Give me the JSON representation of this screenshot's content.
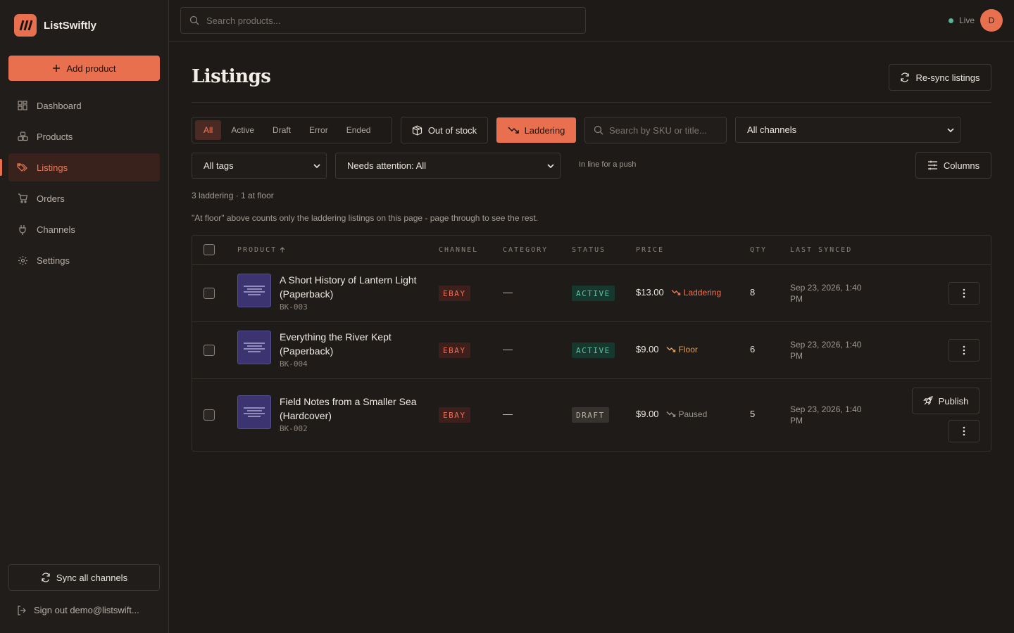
{
  "app": {
    "name": "ListSwiftly"
  },
  "sidebar": {
    "add_button": "Add product",
    "items": [
      {
        "label": "Dashboard",
        "icon": "grid-icon"
      },
      {
        "label": "Products",
        "icon": "boxes-icon"
      },
      {
        "label": "Listings",
        "icon": "tags-icon",
        "active": true
      },
      {
        "label": "Orders",
        "icon": "cart-icon"
      },
      {
        "label": "Channels",
        "icon": "plug-icon"
      },
      {
        "label": "Settings",
        "icon": "gear-icon"
      }
    ],
    "sync_all": "Sync all channels",
    "sign_out": "Sign out demo@listswift..."
  },
  "topbar": {
    "search_placeholder": "Search products...",
    "live_label": "Live",
    "avatar_initial": "D"
  },
  "page": {
    "title": "Listings",
    "resync_button": "Re-sync listings"
  },
  "filters": {
    "status_tabs": [
      "All",
      "Active",
      "Draft",
      "Error",
      "Ended"
    ],
    "active_status_tab": "All",
    "out_of_stock": "Out of stock",
    "laddering": "Laddering",
    "search_placeholder": "Search by SKU or title...",
    "channel_select": "All channels",
    "tags_select": "All tags",
    "attention_select": "Needs attention: All",
    "inline_note": "In line for a push",
    "columns_button": "Columns"
  },
  "summary": "3 laddering · 1 at floor",
  "note": "\"At floor\" above counts only the laddering listings on this page - page through to see the rest.",
  "table": {
    "headers": {
      "product": "PRODUCT",
      "channel": "CHANNEL",
      "category": "CATEGORY",
      "status": "STATUS",
      "price": "PRICE",
      "qty": "QTY",
      "last_synced": "LAST SYNCED"
    },
    "rows": [
      {
        "title": "A Short History of Lantern Light (Paperback)",
        "sku": "BK-003",
        "channel": "EBAY",
        "category": "—",
        "status": "ACTIVE",
        "price": "$13.00",
        "ladder_state": "Laddering",
        "qty": "8",
        "last_synced": "Sep 23, 2026, 1:40 PM"
      },
      {
        "title": "Everything the River Kept (Paperback)",
        "sku": "BK-004",
        "channel": "EBAY",
        "category": "—",
        "status": "ACTIVE",
        "price": "$9.00",
        "ladder_state": "Floor",
        "qty": "6",
        "last_synced": "Sep 23, 2026, 1:40 PM"
      },
      {
        "title": "Field Notes from a Smaller Sea (Hardcover)",
        "sku": "BK-002",
        "channel": "EBAY",
        "category": "—",
        "status": "DRAFT",
        "price": "$9.00",
        "ladder_state": "Paused",
        "qty": "5",
        "last_synced": "Sep 23, 2026, 1:40 PM",
        "publish_button": "Publish"
      }
    ]
  },
  "colors": {
    "accent": "#e8704f",
    "background": "#1d1a18",
    "active_status": "#5fc2a0",
    "channel_badge": "#ec6f57",
    "floor": "#e0a35a"
  }
}
